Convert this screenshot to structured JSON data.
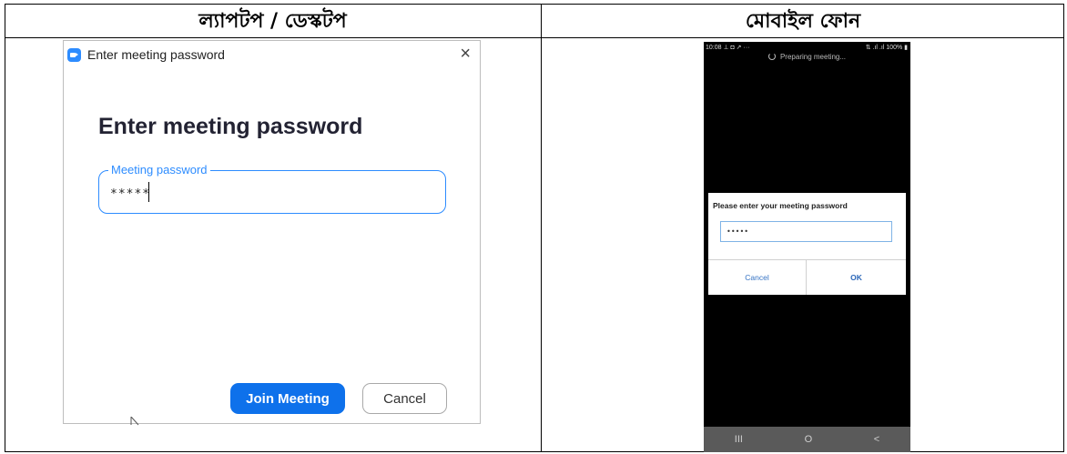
{
  "table": {
    "left_header": "ল্যাপটপ / ডেস্কটপ",
    "right_header": "মোবাইল ফোন"
  },
  "desktop": {
    "window_title": "Enter meeting password",
    "close_glyph": "×",
    "heading": "Enter meeting password",
    "field_label": "Meeting password",
    "field_value": "*****",
    "join_label": "Join Meeting",
    "cancel_label": "Cancel",
    "colors": {
      "accent": "#0e71eb",
      "field_border": "#2d8cff"
    }
  },
  "mobile": {
    "status_time": "10:08 ⊥ ◘ ↗ ···",
    "status_right": "⇅ .ıl .ıl 100% ▮",
    "preparing": "Preparing meeting...",
    "dialog_title": "Please enter your meeting password",
    "field_value": "•••••",
    "cancel_label": "Cancel",
    "ok_label": "OK",
    "nav": [
      "III",
      "O",
      "<"
    ]
  }
}
